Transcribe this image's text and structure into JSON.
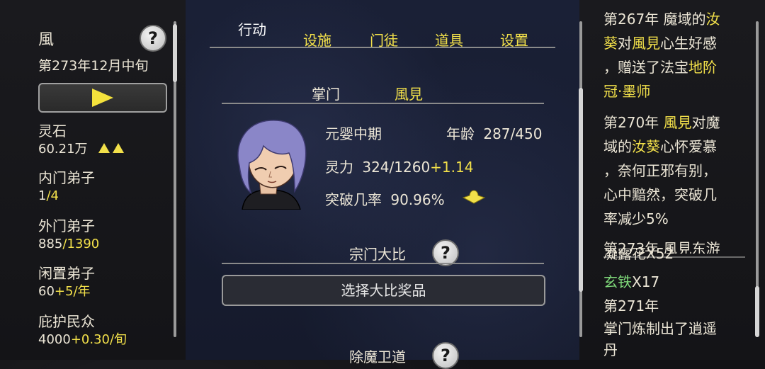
{
  "left": {
    "name": "風",
    "date": "第273年12月中旬",
    "stats": [
      {
        "label": "灵石",
        "value": "60.21万",
        "extra": ""
      },
      {
        "label": "内门弟子",
        "value_a": "1",
        "value_b": "/4"
      },
      {
        "label": "外门弟子",
        "value_a": "885",
        "value_b": "/1390"
      },
      {
        "label": "闲置弟子",
        "value_a": "60",
        "value_b": "+5/年"
      },
      {
        "label": "庇护民众",
        "value_a": "4000",
        "value_b": "+0.30/旬"
      }
    ]
  },
  "tabs": [
    {
      "label": "行动",
      "active": true
    },
    {
      "label": "设施",
      "active": false
    },
    {
      "label": "门徒",
      "active": false
    },
    {
      "label": "道具",
      "active": false
    },
    {
      "label": "设置",
      "active": false
    }
  ],
  "leader": {
    "title": "掌门",
    "name": "風見",
    "realm": "元婴中期",
    "age_label": "年龄",
    "age": "287/450",
    "spirit_label": "灵力",
    "spirit": "324/1260",
    "spirit_rate": "+1.14",
    "breakthrough_label": "突破几率",
    "breakthrough": "90.96%"
  },
  "tournament": {
    "title": "宗门大比",
    "prize_button": "选择大比奖品"
  },
  "next_section": "除魔卫道",
  "log": {
    "e1_year": "第267年 ",
    "e1_a": "魔域的",
    "e1_b": "汝",
    "e1_c": "葵",
    "e1_d": "对",
    "e1_e": "風見",
    "e1_f": "心生好感",
    "e1_g": "，赠送了法宝",
    "e1_h": "地阶",
    "e1_i": "冠·墨师",
    "e2_year": "第270年 ",
    "e2_a": "風見",
    "e2_b": "对魔",
    "e2_c": "域的",
    "e2_d": "汝葵",
    "e2_e": "心怀爱慕",
    "e2_f": "，奈何正邪有别，",
    "e2_g": "心中黯然，突破几",
    "e2_h": "率减少5%",
    "e3_partial": "第273年 風見东游"
  },
  "bag": {
    "item0": "凝露花X52",
    "item1_name": "玄铁",
    "item1_qty": "X17",
    "year": "第271年",
    "line1": "掌门炼制出了逍遥",
    "line2": "丹"
  }
}
